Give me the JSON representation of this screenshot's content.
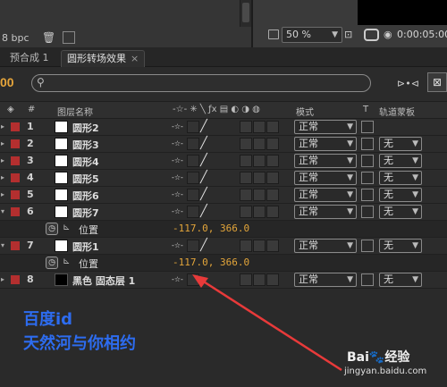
{
  "toolbar": {
    "bpc": "8 bpc",
    "zoom": "50 %",
    "timecode": "0:00:05:00"
  },
  "tabs": [
    {
      "label": "预合成 1"
    },
    {
      "label": "圆形转场效果",
      "close": "×"
    }
  ],
  "panel": {
    "current_time": "00",
    "columns": {
      "number": "#",
      "source_name": "图层名称",
      "mode": "模式",
      "t": "T",
      "track_matte": "轨道蒙板"
    }
  },
  "layers": [
    {
      "num": "1",
      "name": "圆形2",
      "mode": "正常",
      "matte": ""
    },
    {
      "num": "2",
      "name": "圆形3",
      "mode": "正常",
      "matte": "无"
    },
    {
      "num": "3",
      "name": "圆形4",
      "mode": "正常",
      "matte": "无"
    },
    {
      "num": "4",
      "name": "圆形5",
      "mode": "正常",
      "matte": "无"
    },
    {
      "num": "5",
      "name": "圆形6",
      "mode": "正常",
      "matte": "无"
    },
    {
      "num": "6",
      "name": "圆形7",
      "mode": "正常",
      "matte": "无"
    },
    {
      "num": "7",
      "name": "圆形1",
      "mode": "正常",
      "matte": "无"
    },
    {
      "num": "8",
      "name": "黑色 固态层 1",
      "mode": "正常",
      "matte": "无"
    }
  ],
  "properties": [
    {
      "label": "位置",
      "value": "-117.0, 366.0"
    },
    {
      "label": "位置",
      "value": "-117.0, 366.0"
    }
  ],
  "annotation": {
    "line1": "百度id",
    "line2": "天然河与你相约",
    "arrow_color": "#e83a3a"
  },
  "watermark": {
    "logo": "Bai",
    "logo_paw": "🐾",
    "logo_tail": "经验",
    "url": "jingyan.baidu.com"
  },
  "colors": {
    "label_red": "#b32f2f",
    "timecode_orange": "#e6a53b",
    "annotation_blue": "#2d6cf0"
  }
}
